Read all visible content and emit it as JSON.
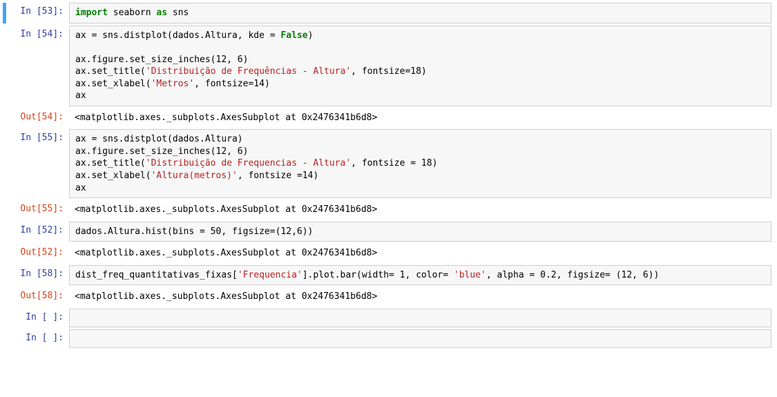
{
  "cells": [
    {
      "type": "code",
      "execCount": 53,
      "selected": true,
      "tokens": [
        {
          "t": "import",
          "c": "tok-kw"
        },
        {
          "t": " seaborn "
        },
        {
          "t": "as",
          "c": "tok-kw"
        },
        {
          "t": " sns"
        }
      ]
    },
    {
      "type": "code",
      "execCount": 54,
      "tokens": [
        {
          "t": "ax = sns.distplot(dados.Altura, kde = "
        },
        {
          "t": "False",
          "c": "tok-bool"
        },
        {
          "t": ")\n\n"
        },
        {
          "t": "ax.figure.set_size_inches(12, 6)\n"
        },
        {
          "t": "ax.set_title("
        },
        {
          "t": "'Distribuição de Frequências - Altura'",
          "c": "tok-str"
        },
        {
          "t": ", fontsize=18)\n"
        },
        {
          "t": "ax.set_xlabel("
        },
        {
          "t": "'Metros'",
          "c": "tok-str"
        },
        {
          "t": ", fontsize=14)\n"
        },
        {
          "t": "ax"
        }
      ]
    },
    {
      "type": "output",
      "execCount": 54,
      "text": "<matplotlib.axes._subplots.AxesSubplot at 0x2476341b6d8>"
    },
    {
      "type": "code",
      "execCount": 55,
      "tokens": [
        {
          "t": "ax = sns.distplot(dados.Altura)\n"
        },
        {
          "t": "ax.figure.set_size_inches(12, 6)\n"
        },
        {
          "t": "ax.set_title("
        },
        {
          "t": "'Distribuição de Frequencias - Altura'",
          "c": "tok-str"
        },
        {
          "t": ", fontsize = 18)\n"
        },
        {
          "t": "ax.set_xlabel("
        },
        {
          "t": "'Altura(metros)'",
          "c": "tok-str"
        },
        {
          "t": ", fontsize =14)\n"
        },
        {
          "t": "ax"
        }
      ]
    },
    {
      "type": "output",
      "execCount": 55,
      "text": "<matplotlib.axes._subplots.AxesSubplot at 0x2476341b6d8>"
    },
    {
      "type": "code",
      "execCount": 52,
      "tokens": [
        {
          "t": "dados.Altura.hist(bins = 50, figsize=(12,6))"
        }
      ]
    },
    {
      "type": "output",
      "execCount": 52,
      "text": "<matplotlib.axes._subplots.AxesSubplot at 0x2476341b6d8>"
    },
    {
      "type": "code",
      "execCount": 58,
      "tokens": [
        {
          "t": "dist_freq_quantitativas_fixas["
        },
        {
          "t": "'Frequencia'",
          "c": "tok-str"
        },
        {
          "t": "].plot.bar(width= 1, color= "
        },
        {
          "t": "'blue'",
          "c": "tok-str"
        },
        {
          "t": ", alpha = 0.2, figsize= (12, 6))"
        }
      ]
    },
    {
      "type": "output",
      "execCount": 58,
      "text": "<matplotlib.axes._subplots.AxesSubplot at 0x2476341b6d8>"
    },
    {
      "type": "code",
      "execCount": null,
      "tokens": []
    },
    {
      "type": "code",
      "execCount": null,
      "tokens": []
    }
  ],
  "labels": {
    "inPrefix": "In [",
    "outPrefix": "Out[",
    "suffix": "]:",
    "emptyIn": "In [ ]:"
  }
}
